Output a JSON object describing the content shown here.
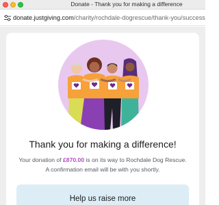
{
  "window": {
    "title": "Donate - Thank you for making a difference"
  },
  "address_bar": {
    "host": "donate.justgiving.com",
    "path": "/charity/rochdale-dogrescue/thank-you/success"
  },
  "confirmation": {
    "headline": "Thank you for making a difference!",
    "line1_before": "Your donation of ",
    "amount": "£870.00",
    "line1_after": " is on its way to Rochdale Dog Rescue.",
    "line2": "A confirmation email will be with you shortly."
  },
  "promo": {
    "title": "Help us raise more"
  },
  "colors": {
    "accent_purple": "#b54cc4",
    "hero_circle": "#e9c8ef",
    "tshirt_orange": "#f6a13a",
    "promo_bg": "#dcedf6"
  }
}
